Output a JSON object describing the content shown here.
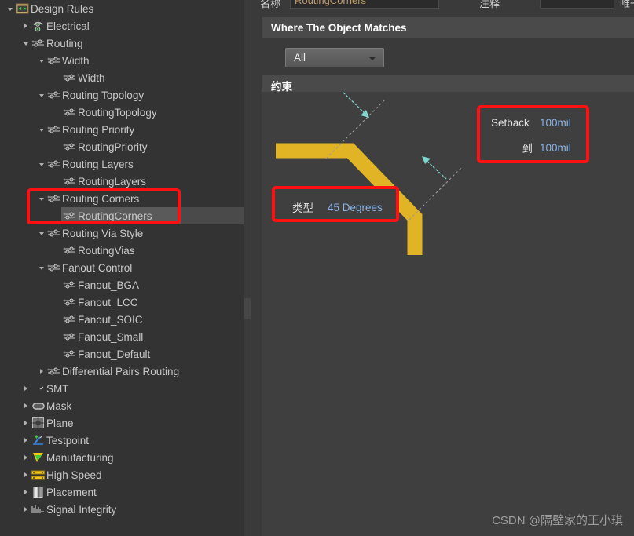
{
  "window": {
    "background": "#3a3a3a",
    "panel_background": "#333333"
  },
  "tree": {
    "items": [
      {
        "label": "Design Rules",
        "depth": 0,
        "toggle": "expanded",
        "icon": "design-rules-folder-icon",
        "selected": false
      },
      {
        "label": "Electrical",
        "depth": 1,
        "toggle": "collapsed",
        "icon": "electrical-icon",
        "selected": false
      },
      {
        "label": "Routing",
        "depth": 1,
        "toggle": "expanded",
        "icon": "routing-icon",
        "selected": false
      },
      {
        "label": "Width",
        "depth": 2,
        "toggle": "expanded",
        "icon": "routing-icon",
        "selected": false
      },
      {
        "label": "Width",
        "depth": 3,
        "toggle": "none",
        "icon": "routing-icon",
        "selected": false
      },
      {
        "label": "Routing Topology",
        "depth": 2,
        "toggle": "expanded",
        "icon": "routing-icon",
        "selected": false
      },
      {
        "label": "RoutingTopology",
        "depth": 3,
        "toggle": "none",
        "icon": "routing-icon",
        "selected": false
      },
      {
        "label": "Routing Priority",
        "depth": 2,
        "toggle": "expanded",
        "icon": "routing-icon",
        "selected": false
      },
      {
        "label": "RoutingPriority",
        "depth": 3,
        "toggle": "none",
        "icon": "routing-icon",
        "selected": false
      },
      {
        "label": "Routing Layers",
        "depth": 2,
        "toggle": "expanded",
        "icon": "routing-icon",
        "selected": false
      },
      {
        "label": "RoutingLayers",
        "depth": 3,
        "toggle": "none",
        "icon": "routing-icon",
        "selected": false
      },
      {
        "label": "Routing Corners",
        "depth": 2,
        "toggle": "expanded",
        "icon": "routing-icon",
        "selected": false
      },
      {
        "label": "RoutingCorners",
        "depth": 3,
        "toggle": "none",
        "icon": "routing-icon",
        "selected": true
      },
      {
        "label": "Routing Via Style",
        "depth": 2,
        "toggle": "expanded",
        "icon": "routing-icon",
        "selected": false
      },
      {
        "label": "RoutingVias",
        "depth": 3,
        "toggle": "none",
        "icon": "routing-icon",
        "selected": false
      },
      {
        "label": "Fanout Control",
        "depth": 2,
        "toggle": "expanded",
        "icon": "routing-icon",
        "selected": false
      },
      {
        "label": "Fanout_BGA",
        "depth": 3,
        "toggle": "none",
        "icon": "routing-icon",
        "selected": false
      },
      {
        "label": "Fanout_LCC",
        "depth": 3,
        "toggle": "none",
        "icon": "routing-icon",
        "selected": false
      },
      {
        "label": "Fanout_SOIC",
        "depth": 3,
        "toggle": "none",
        "icon": "routing-icon",
        "selected": false
      },
      {
        "label": "Fanout_Small",
        "depth": 3,
        "toggle": "none",
        "icon": "routing-icon",
        "selected": false
      },
      {
        "label": "Fanout_Default",
        "depth": 3,
        "toggle": "none",
        "icon": "routing-icon",
        "selected": false
      },
      {
        "label": "Differential Pairs Routing",
        "depth": 2,
        "toggle": "collapsed",
        "icon": "routing-icon",
        "selected": false
      },
      {
        "label": "SMT",
        "depth": 1,
        "toggle": "collapsed",
        "icon": "smt-icon",
        "selected": false
      },
      {
        "label": "Mask",
        "depth": 1,
        "toggle": "collapsed",
        "icon": "mask-icon",
        "selected": false
      },
      {
        "label": "Plane",
        "depth": 1,
        "toggle": "collapsed",
        "icon": "plane-icon",
        "selected": false
      },
      {
        "label": "Testpoint",
        "depth": 1,
        "toggle": "collapsed",
        "icon": "testpoint-icon",
        "selected": false
      },
      {
        "label": "Manufacturing",
        "depth": 1,
        "toggle": "collapsed",
        "icon": "manufacturing-icon",
        "selected": false
      },
      {
        "label": "High Speed",
        "depth": 1,
        "toggle": "collapsed",
        "icon": "high-speed-icon",
        "selected": false
      },
      {
        "label": "Placement",
        "depth": 1,
        "toggle": "collapsed",
        "icon": "placement-icon",
        "selected": false
      },
      {
        "label": "Signal Integrity",
        "depth": 1,
        "toggle": "collapsed",
        "icon": "signal-integrity-icon",
        "selected": false
      }
    ]
  },
  "top_toolbar": {
    "name_label": "名称",
    "name_value": "RoutingCorners",
    "comment_label": "注释",
    "comment_value": "",
    "unique_id_label": "唯一 ID"
  },
  "where_section": {
    "title": "Where The Object Matches",
    "scope_value": "All"
  },
  "constraints_section": {
    "title": "约束",
    "style_label": "类型",
    "style_value": "45 Degrees",
    "setback_label": "Setback",
    "setback_value": "100mil",
    "to_label": "到",
    "to_value": "100mil"
  },
  "colors": {
    "track_yellow": "#e0b424",
    "callout_red": "#ff1111",
    "value_blue": "#8ab4e8",
    "arrow_cyan": "#7fd8d0"
  },
  "watermark": {
    "text": "CSDN @隔壁家的王小琪"
  }
}
